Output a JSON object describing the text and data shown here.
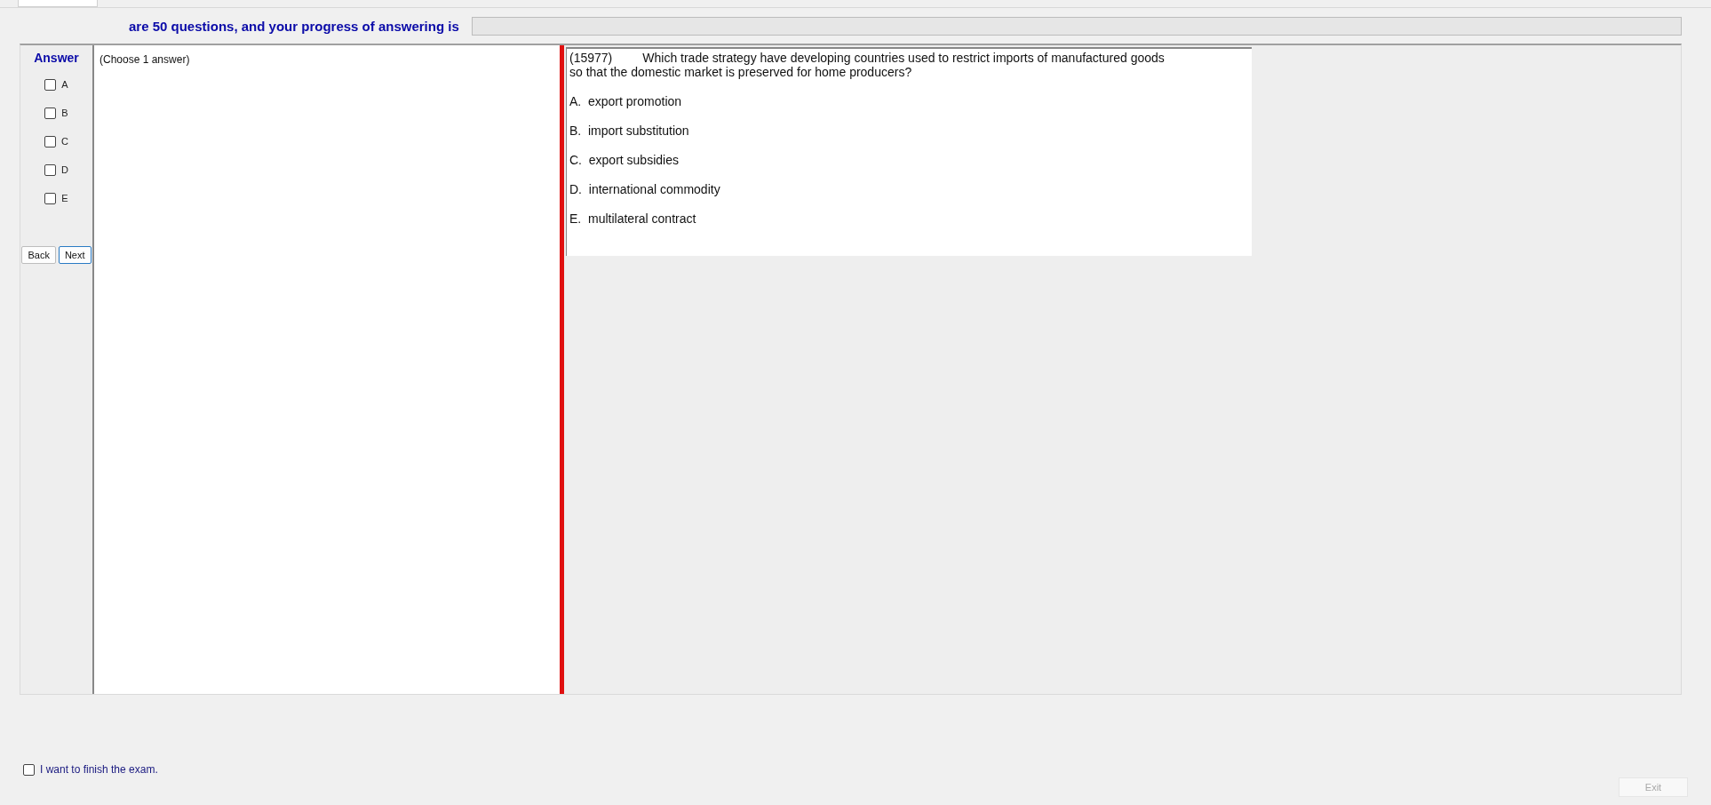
{
  "header": {
    "progress_text": "are 50 questions, and your progress of answering is",
    "progress": {
      "level": 0
    }
  },
  "answer_panel": {
    "title": "Answer",
    "options": [
      {
        "label": "A",
        "checked": false
      },
      {
        "label": "B",
        "checked": false
      },
      {
        "label": "C",
        "checked": false
      },
      {
        "label": "D",
        "checked": false
      },
      {
        "label": "E",
        "checked": false
      }
    ],
    "buttons": [
      {
        "label": "Back",
        "focused": false
      },
      {
        "label": "Next",
        "focused": true
      }
    ]
  },
  "instruction": "(Choose 1 answer)",
  "question": {
    "number": "(15977)",
    "text": "Which trade strategy have developing countries used to restrict imports of manufactured goods",
    "text_line_2": "so that the domestic market is preserved for home producers?",
    "choices": [
      "A.  export promotion",
      "B.  import substitution",
      "C.  export subsidies",
      "D.  international commodity",
      "E.  multilateral contract"
    ]
  },
  "finish": {
    "label": "I want to finish the exam.",
    "checked": false
  },
  "exit_button": {
    "label": "Exit",
    "disabled": true
  }
}
